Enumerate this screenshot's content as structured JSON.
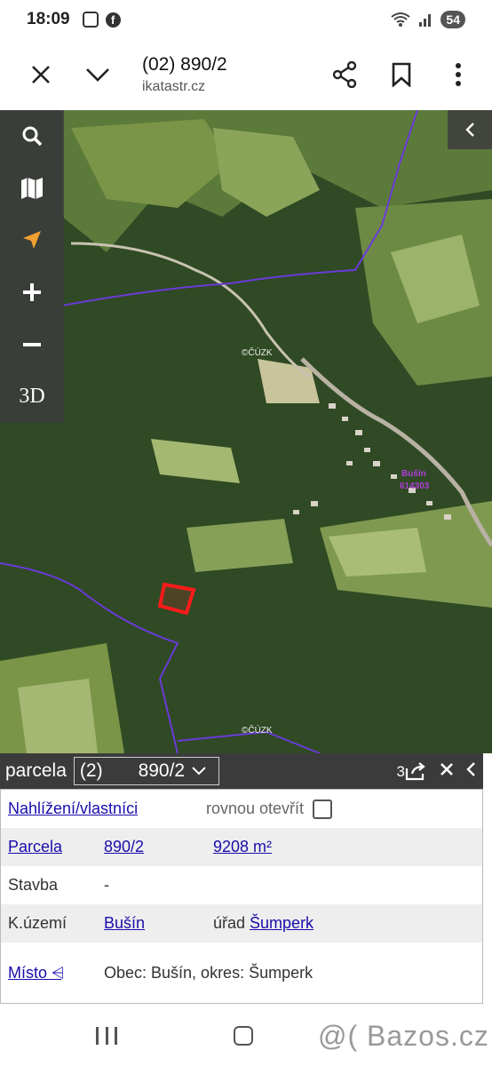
{
  "status": {
    "time": "18:09",
    "battery": "54"
  },
  "toolbar": {
    "title": "(02) 890/2",
    "url": "ikatastr.cz"
  },
  "map": {
    "copyright": "©ČÚZK",
    "place_label": "Bušín",
    "place_code": "614303"
  },
  "sidebar": {
    "btn_3d": "3D"
  },
  "panel": {
    "label": "parcela",
    "select_prefix": "(2)",
    "select_value": "890/2",
    "share_count": "3",
    "rows": {
      "nahlizeni": "Nahlížení/vlastníci",
      "rovnou": "rovnou otevřít",
      "parcela_label": "Parcela",
      "parcela_value": "890/2",
      "parcela_area": "9208 m²",
      "stavba_label": "Stavba",
      "stavba_value": "-",
      "ku_label": "K.území",
      "ku_value": "Bušín",
      "urad_label": "úřad",
      "urad_value": "Šumperk",
      "misto_label": "Místo ⩤",
      "misto_value": "Obec: Bušín, okres: Šumperk"
    }
  },
  "watermark": "@( Bazos.cz"
}
